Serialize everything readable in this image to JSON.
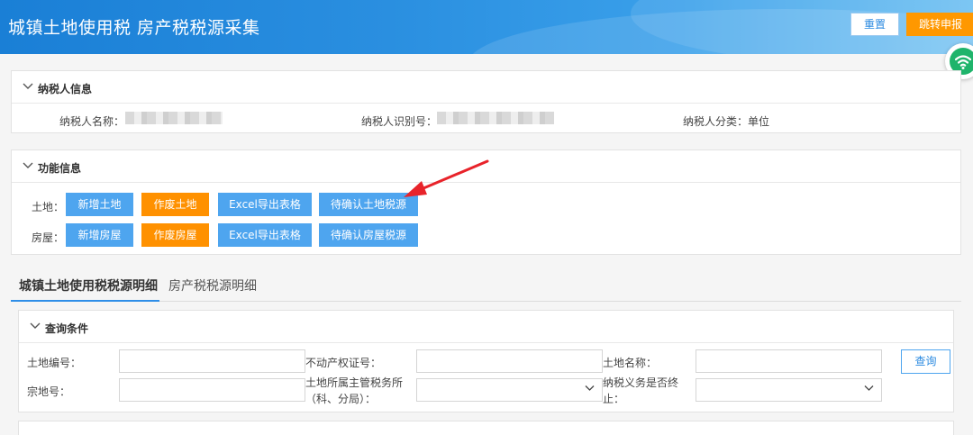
{
  "header": {
    "title": "城镇土地使用税 房产税税源采集",
    "reset_label": "重置",
    "jump_label": "跳转申报"
  },
  "taxpayer_panel": {
    "title": "纳税人信息",
    "name_label": "纳税人名称：",
    "id_label": "纳税人识别号：",
    "category_label": "纳税人分类：",
    "category_value": "单位"
  },
  "function_panel": {
    "title": "功能信息",
    "land_label": "土地：",
    "house_label": "房屋：",
    "land_buttons": [
      "新增土地",
      "作废土地",
      "Excel导出表格",
      "待确认土地税源"
    ],
    "house_buttons": [
      "新增房屋",
      "作废房屋",
      "Excel导出表格",
      "待确认房屋税源"
    ]
  },
  "tabs": {
    "active": "城镇土地使用税税源明细",
    "inactive": "房产税税源明细"
  },
  "query_panel": {
    "title": "查询条件",
    "land_no_label": "土地编号：",
    "property_cert_label": "不动产权证号：",
    "land_name_label": "土地名称：",
    "parcel_no_label": "宗地号：",
    "tax_office_label_line1": "土地所属主管税务所",
    "tax_office_label_line2": "（科、分局）：",
    "obligation_label_line1": "纳税义务是否终",
    "obligation_label_line2": "止：",
    "query_button": "查询"
  },
  "colors": {
    "header_blue": "#1a7fd6",
    "button_blue": "#4ea5ef",
    "button_orange": "#ff9100",
    "annotation_red": "#e8232a"
  },
  "icons": {
    "collapse": "chevron-down-icon",
    "select": "chevron-down-icon",
    "float": "wifi-icon"
  }
}
